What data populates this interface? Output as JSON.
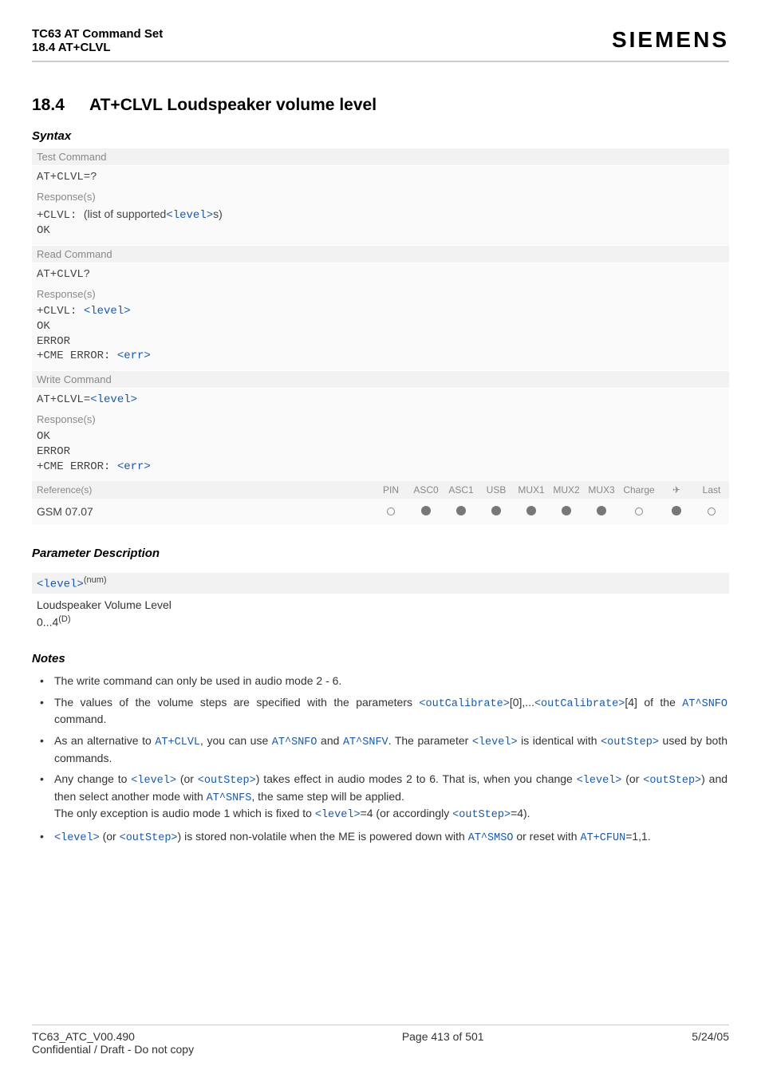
{
  "header": {
    "title": "TC63 AT Command Set",
    "subtitle": "18.4 AT+CLVL",
    "brand": "SIEMENS"
  },
  "section": {
    "number": "18.4",
    "title": "AT+CLVL   Loudspeaker volume level"
  },
  "syntax": {
    "label": "Syntax",
    "test": {
      "box_label": "Test Command",
      "cmd": "AT+CLVL=?",
      "resp_label": "Response(s)",
      "resp_prefix": "+CLVL: ",
      "resp_text_before": "(list of supported",
      "resp_param": "<level>",
      "resp_text_after": "s)",
      "ok": "OK"
    },
    "read": {
      "box_label": "Read Command",
      "cmd": "AT+CLVL?",
      "resp_label": "Response(s)",
      "resp_prefix": "+CLVL: ",
      "resp_param": "<level>",
      "ok": "OK",
      "error": "ERROR",
      "cme_prefix": "+CME ERROR: ",
      "cme_param": "<err>"
    },
    "write": {
      "box_label": "Write Command",
      "cmd_prefix": "AT+CLVL=",
      "cmd_param": "<level>",
      "resp_label": "Response(s)",
      "ok": "OK",
      "error": "ERROR",
      "cme_prefix": "+CME ERROR: ",
      "cme_param": "<err>"
    }
  },
  "ref": {
    "label": "Reference(s)",
    "cols": [
      "PIN",
      "ASC0",
      "ASC1",
      "USB",
      "MUX1",
      "MUX2",
      "MUX3",
      "Charge",
      "✈",
      "Last"
    ],
    "value": "GSM 07.07",
    "states": [
      "empty",
      "filled",
      "filled",
      "filled",
      "filled",
      "filled",
      "filled",
      "empty",
      "filled",
      "empty"
    ]
  },
  "param": {
    "heading": "Parameter Description",
    "name": "<level>",
    "sup": "(num)",
    "desc": "Loudspeaker Volume Level",
    "range": "0...4",
    "range_sup": "(D)"
  },
  "notes": {
    "heading": "Notes",
    "items": {
      "n0": "The write command can only be used in audio mode 2 - 6.",
      "n1a": "The values of the volume steps are specified with the parameters ",
      "n1b": "<outCalibrate>",
      "n1c": "[0],...",
      "n1d": "<outCalibrate>",
      "n1e": "[4] of the ",
      "n1f": "AT^SNFO",
      "n1g": " command.",
      "n2a": "As an alternative to ",
      "n2b": "AT+CLVL",
      "n2c": ", you can use ",
      "n2d": "AT^SNFO",
      "n2e": " and ",
      "n2f": "AT^SNFV",
      "n2g": ". The parameter ",
      "n2h": "<level>",
      "n2i": " is identical with ",
      "n2j": "<outStep>",
      "n2k": " used by both commands.",
      "n3a": "Any change to ",
      "n3b": "<level>",
      "n3c": " (or ",
      "n3d": "<outStep>",
      "n3e": ") takes effect in audio modes 2 to 6. That is, when you change ",
      "n3f": "<level>",
      "n3g": " (or ",
      "n3h": "<outStep>",
      "n3i": ") and then select another mode with ",
      "n3j": "AT^SNFS",
      "n3k": ", the same step will be applied.",
      "n3l": "The only exception is audio mode 1 which is fixed to ",
      "n3m": "<level>",
      "n3n": "=4 (or accordingly ",
      "n3o": "<outStep>",
      "n3p": "=4).",
      "n4a": "<level>",
      "n4b": " (or ",
      "n4c": "<outStep>",
      "n4d": ") is stored non-volatile when the ME is powered down with ",
      "n4e": "AT^SMSO",
      "n4f": " or reset with ",
      "n4g": "AT+CFUN",
      "n4h": "=1,1."
    }
  },
  "footer": {
    "left1": "TC63_ATC_V00.490",
    "left2": "Confidential / Draft - Do not copy",
    "center": "Page 413 of 501",
    "right": "5/24/05"
  }
}
